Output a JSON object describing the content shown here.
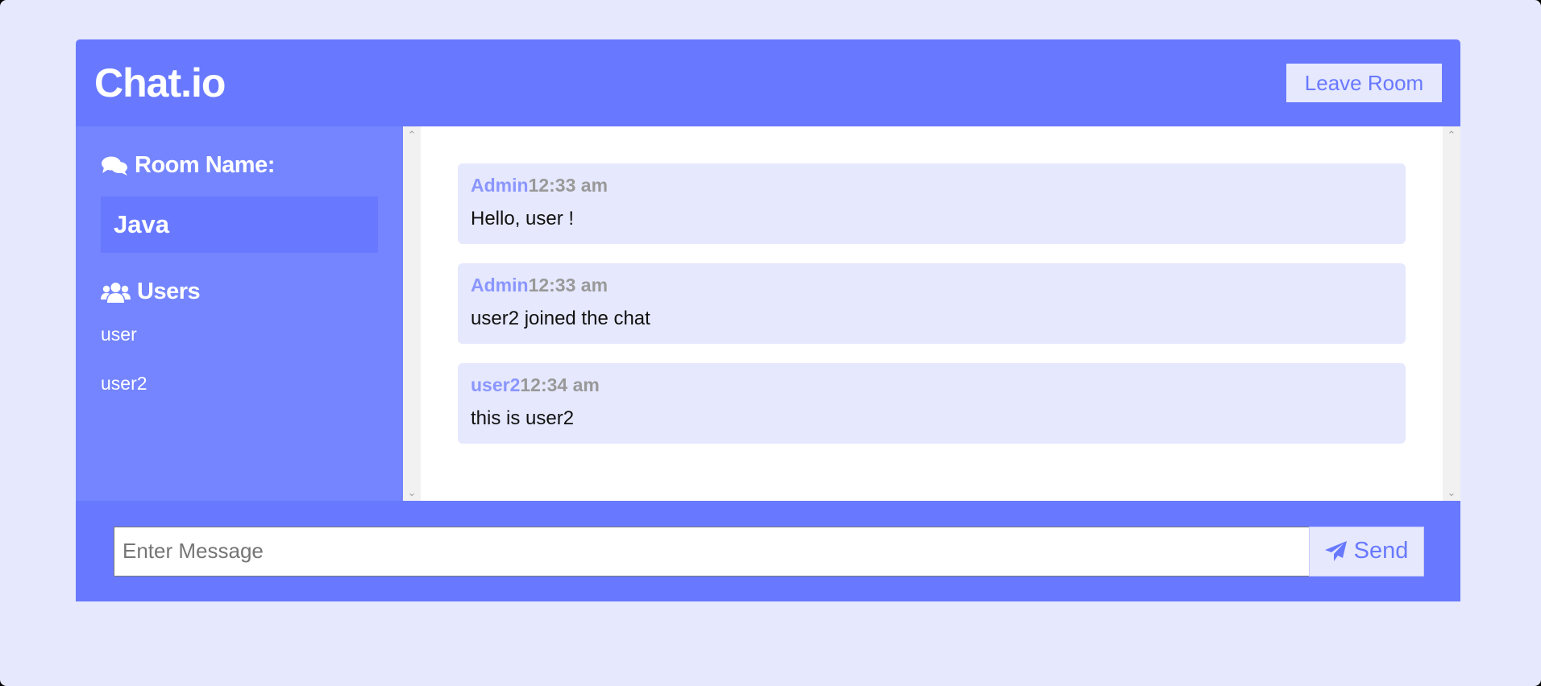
{
  "header": {
    "logo": "Chat.io",
    "leave_button": "Leave Room"
  },
  "sidebar": {
    "room_heading": "Room Name:",
    "room_heading_icon": "comments-icon",
    "room_name": "Java",
    "users_heading": "Users",
    "users_heading_icon": "users-icon",
    "users": [
      "user",
      "user2"
    ]
  },
  "messages": [
    {
      "author": "Admin",
      "time": "12:33 am",
      "text": "Hello, user !"
    },
    {
      "author": "Admin",
      "time": "12:33 am",
      "text": "user2 joined the chat"
    },
    {
      "author": "user2",
      "time": "12:34 am",
      "text": "this is user2"
    }
  ],
  "composer": {
    "placeholder": "Enter Message",
    "value": "",
    "send_button": "Send",
    "send_icon": "paper-plane-icon"
  },
  "colors": {
    "primary": "#6879ff",
    "sidebar": "#7485ff",
    "light": "#e6e8fd",
    "author": "#8a96ff",
    "time": "#999999"
  }
}
